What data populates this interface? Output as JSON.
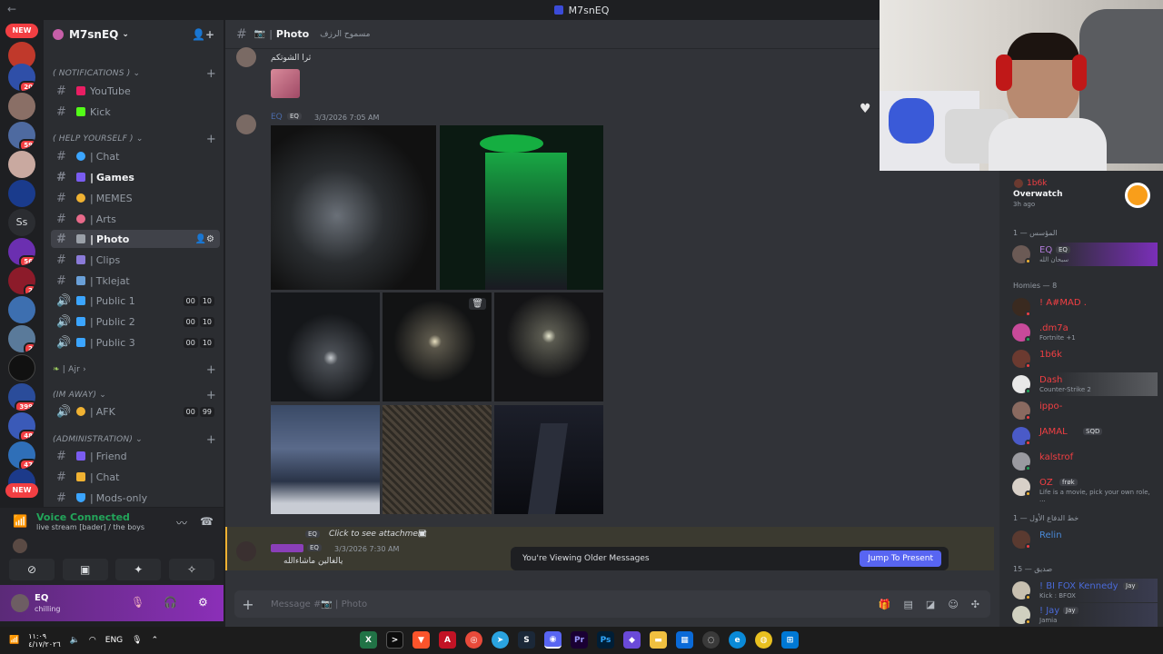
{
  "window": {
    "title": "M7snEQ"
  },
  "rail": {
    "new_top": "NEW",
    "new_bottom": "NEW",
    "ss_label": "Ss",
    "badges": [
      "20",
      "59",
      "56",
      "2",
      "2",
      "399",
      "48",
      "47"
    ]
  },
  "guild": {
    "name": "M7snEQ"
  },
  "categories": {
    "notifications": "( NOTIFICATIONS )",
    "help_yourself": "( HELP YOURSELF )",
    "ajr": "Ajr",
    "im_away": "(IM AWAY)",
    "administration": "(ADMINISTRATION)"
  },
  "channels": {
    "youtube": "YouTube",
    "kick": "Kick",
    "chat": "Chat",
    "games": "Games",
    "memes": "MEMES",
    "arts": "Arts",
    "photo": "Photo",
    "clips": "Clips",
    "tklejat": "Tklejat",
    "public1": "Public 1",
    "public2": "Public 2",
    "public3": "Public 3",
    "afk": "AFK",
    "friend": "Friend",
    "chat2": "Chat",
    "mods_only": "Mods-only"
  },
  "voice_counts": {
    "public1": [
      "00",
      "10"
    ],
    "public2": [
      "00",
      "10"
    ],
    "public3": [
      "00",
      "10"
    ],
    "afk": [
      "00",
      "99"
    ]
  },
  "voice": {
    "status": "Voice Connected",
    "channel": "live stream [bader] / the boys"
  },
  "user": {
    "name": "EQ",
    "status": "chilling"
  },
  "header": {
    "channel_name": "Photo",
    "topic": "مسموح الرزف"
  },
  "messages": [
    {
      "text": "ثرا الشوتكم"
    },
    {
      "author": "EQ",
      "tag": "EQ",
      "time": "3/3/2026 7:05 AM"
    },
    {
      "reply_tag": "EQ",
      "reply_text": "Click to see attachment",
      "tag": "EQ",
      "time": "3/3/2026 7:30 AM",
      "text": "يالغالين ماشاءالله"
    }
  ],
  "older": {
    "text": "You're Viewing Older Messages",
    "button": "Jump To Present"
  },
  "composer": {
    "placeholder": "Message #📷 | Photo"
  },
  "activity": {
    "user": "1b6k",
    "game": "Overwatch",
    "time": "3h ago"
  },
  "member_sections": {
    "founder": "المؤسس — 1",
    "homies": "Homies — 8",
    "defense": "خط الدفاع الأول — 1",
    "friend": "صديق — 15"
  },
  "members": [
    {
      "name": "EQ",
      "tag": "EQ",
      "sub": "سبحان الله"
    },
    {
      "name": "! A#MAD .",
      "sub": ""
    },
    {
      "name": ".dm7a",
      "sub": "Fortnite +1"
    },
    {
      "name": "1b6k",
      "sub": ""
    },
    {
      "name": "Dash",
      "sub": "Counter-Strike 2"
    },
    {
      "name": "ippo-",
      "sub": ""
    },
    {
      "name": "JAMAL",
      "tag": "SQD",
      "sub": ""
    },
    {
      "name": "kalstrof",
      "sub": ""
    },
    {
      "name": "OZ",
      "tag": "frøk",
      "sub": "Life is a movie, pick your own role, ..."
    },
    {
      "name": "Relin",
      "sub": ""
    },
    {
      "name": "! BI FOX Kennedy",
      "tag": "Jay",
      "sub": "Kick : BFOX"
    },
    {
      "name": "! Jay",
      "tag": "Jay",
      "sub": "Jamia"
    }
  ],
  "taskbar": {
    "time": "١١:٠٩",
    "date": "٤/١٧/٢٠٢٦",
    "lang": "ENG"
  },
  "colors": {
    "accent": "#5865f2",
    "online": "#23a55a",
    "dnd": "#f23f43",
    "idle": "#f0b232"
  }
}
